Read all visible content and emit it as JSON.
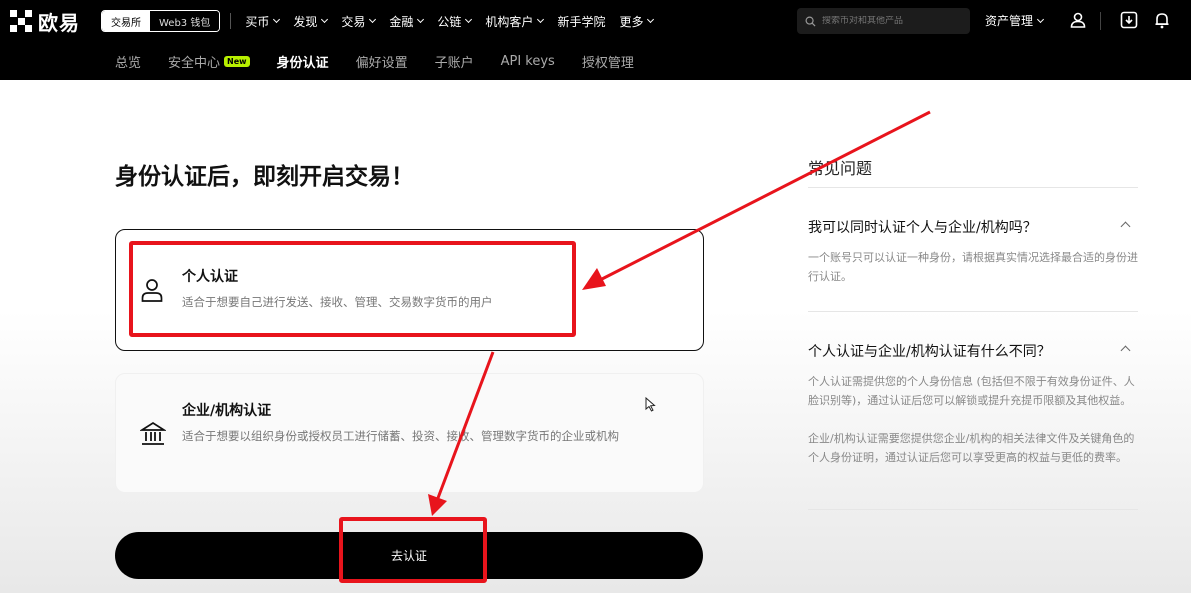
{
  "brand": {
    "name": "欧易"
  },
  "header": {
    "switch": {
      "exchange": "交易所",
      "web3": "Web3 钱包"
    },
    "nav": [
      {
        "label": "买币"
      },
      {
        "label": "发现"
      },
      {
        "label": "交易"
      },
      {
        "label": "金融"
      },
      {
        "label": "公链"
      },
      {
        "label": "机构客户"
      },
      {
        "label": "新手学院"
      },
      {
        "label": "更多"
      }
    ],
    "search_placeholder": "搜索币对和其他产品",
    "asset": "资产管理",
    "icons": [
      "user-icon",
      "download-icon",
      "bell-icon"
    ]
  },
  "subnav": {
    "items": [
      {
        "label": "总览"
      },
      {
        "label": "安全中心",
        "badge": "New"
      },
      {
        "label": "身份认证",
        "active": true
      },
      {
        "label": "偏好设置"
      },
      {
        "label": "子账户"
      },
      {
        "label": "API keys"
      },
      {
        "label": "授权管理"
      }
    ]
  },
  "main": {
    "heading": "身份认证后，即刻开启交易！",
    "options": [
      {
        "title": "个人认证",
        "desc": "适合于想要自己进行发送、接收、管理、交易数字货币的用户",
        "icon": "person-icon",
        "selected": true
      },
      {
        "title": "企业/机构认证",
        "desc": "适合于想要以组织身份或授权员工进行储蓄、投资、接收、管理数字货币的企业或机构",
        "icon": "bank-icon"
      }
    ],
    "cta": "去认证"
  },
  "faq": {
    "title": "常见问题",
    "items": [
      {
        "q": "我可以同时认证个人与企业/机构吗？",
        "a": "一个账号只可以认证一种身份，请根据真实情况选择最合适的身份进行认证。"
      },
      {
        "q": "个人认证与企业/机构认证有什么不同？",
        "a1": "个人认证需提供您的个人身份信息 (包括但不限于有效身份证件、人脸识别等)，通过认证后您可以解锁或提升充提币限额及其他权益。",
        "a2": "企业/机构认证需要您提供您企业/机构的相关法律文件及关键角色的个人身份证明，通过认证后您可以享受更高的权益与更低的费率。"
      }
    ]
  },
  "colors": {
    "accent_red": "#e8141c",
    "new_badge": "#b8f000",
    "bar_bg": "#000000"
  }
}
